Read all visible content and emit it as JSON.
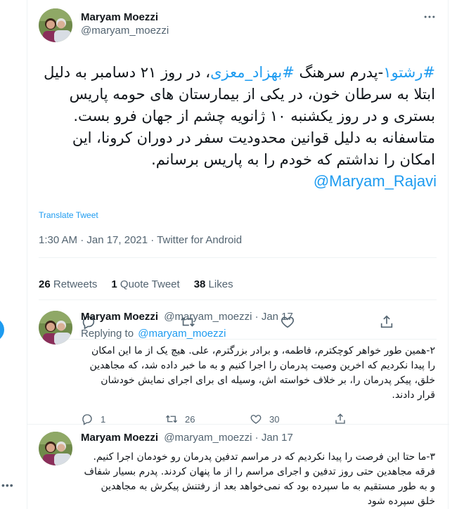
{
  "main_tweet": {
    "author_name": "Maryam Moezzi",
    "author_handle": "@maryam_moezzi",
    "body": {
      "hashtag1": "#رشتو۱",
      "part1": "-پدرم سرهنگ ",
      "hashtag2": "#بهزاد_معزی",
      "part2": "، در روز ۲۱ دسامبر به دلیل ابتلا به سرطان خون، در یکی از بیمارستان های حومه پاریس بستری و در روز یکشنبه ۱۰ ژانویه چشم از جهان فرو بست. متاسفانه به دلیل قوانین محدودیت سفر در دوران کرونا، این امکان را نداشتم که خودم را به پاریس برسانم.",
      "mention": "@Maryam_Rajavi"
    },
    "translate_label": "Translate Tweet",
    "timestamp": "1:30 AM · Jan 17, 2021 · Twitter for Android",
    "stats": {
      "retweets_count": "26",
      "retweets_label": "Retweets",
      "quotes_count": "1",
      "quotes_label": "Quote Tweet",
      "likes_count": "38",
      "likes_label": "Likes"
    },
    "actions": [
      "reply-icon",
      "retweet-icon",
      "like-icon",
      "share-icon"
    ]
  },
  "replies": [
    {
      "author_name": "Maryam Moezzi",
      "author_handle": "@maryam_moezzi",
      "time": "· Jan 17",
      "replying_label": "Replying to",
      "replying_to": "@maryam_moezzi",
      "body": "۲-همین طور خواهر کوچکترم، فاطمه، و برادر بزرگترم، علی. هیچ یک از ما این امکان را پیدا نکردیم که اخرین وصیت پدرمان را اجرا کنیم و به ما خبر داده شد، که مجاهدین خلق، پیکر پدرمان را، بر خلاف خواسته اش، وسیله ای برای اجرای نمایش خودشان قرار دادند.",
      "reply_count": "1",
      "retweet_count": "26",
      "like_count": "30"
    },
    {
      "author_name": "Maryam Moezzi",
      "author_handle": "@maryam_moezzi",
      "time": "· Jan 17",
      "body": "۳-ما حتا این فرصت را پیدا نکردیم که در مراسم تدفین پدرمان رو خودمان اجرا کنیم. فرقه مجاهدین حتی روز تدفین و اجرای مراسم را از ما پنهان کردند. پدرم بسیار شفاف و به طور مستقیم به ما سپرده بود که نمی‌خواهد بعد از رفتنش پیکرش به مجاهدین خلق سپرده شود"
    }
  ],
  "colors": {
    "accent": "#1d9bf0",
    "text": "#0f1419",
    "muted": "#536471",
    "border": "#eff3f4"
  }
}
